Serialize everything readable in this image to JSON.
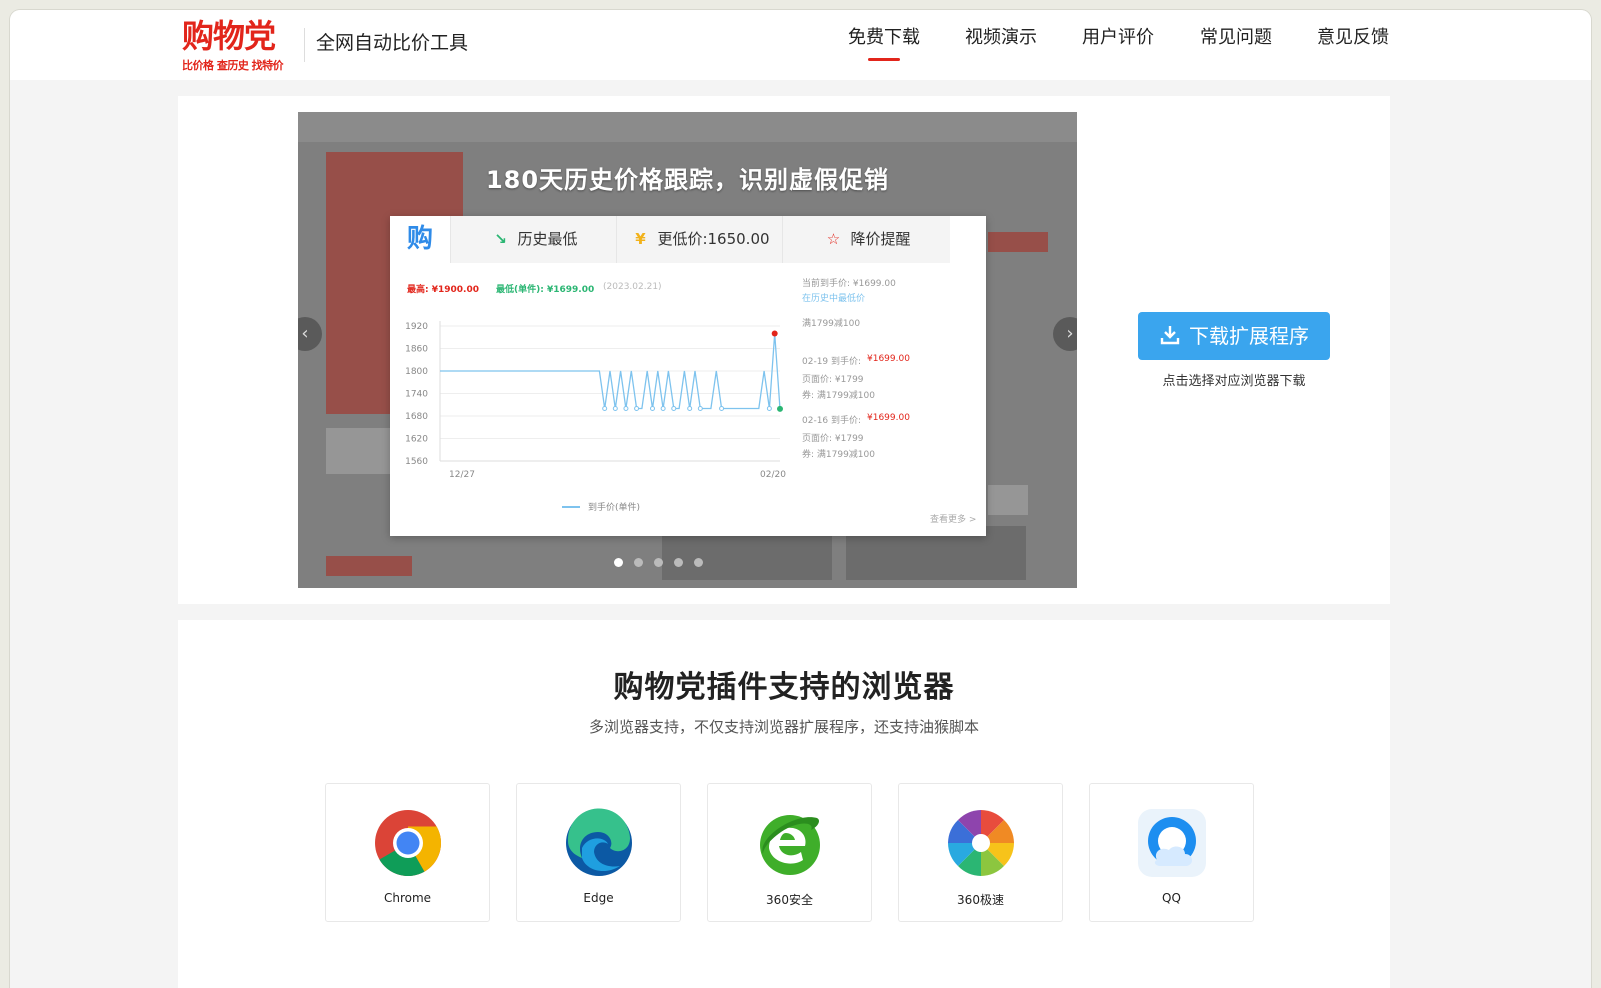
{
  "header": {
    "logo_main": "购物党",
    "logo_sub": "比价格 查历史 找特价",
    "slogan": "全网自动比价工具",
    "nav": [
      {
        "label": "免费下载",
        "active": true
      },
      {
        "label": "视频演示",
        "active": false
      },
      {
        "label": "用户评价",
        "active": false
      },
      {
        "label": "常见问题",
        "active": false
      },
      {
        "label": "意见反馈",
        "active": false
      }
    ]
  },
  "carousel": {
    "title": "180天历史价格跟踪，识别虚假促销",
    "prev_icon": "chevron-left-icon",
    "next_icon": "chevron-right-icon",
    "dots_total": 5,
    "dots_active_index": 0,
    "popup": {
      "logo": "购",
      "tabs": [
        "历史最低",
        "更低价:1650.00",
        "降价提醒"
      ],
      "max_label": "最高: ¥1900.00",
      "min_label": "最低(单件): ¥1699.00",
      "min_date": "(2023.02.21)",
      "legend": "到手价(单件)",
      "more": "查看更多 >",
      "side": {
        "current": "当前到手价: ¥1699.00",
        "history_low": "在历史中最低价",
        "coupon": "满1799减100",
        "e1_date": "02-19 到手价:",
        "e1_price": "¥1699.00",
        "e1_face": "页面价: ¥1799",
        "e1_coupon": "券: 满1799减100",
        "e2_date": "02-16 到手价:",
        "e2_price": "¥1699.00",
        "e2_face": "页面价: ¥1799",
        "e2_coupon": "券: 满1799减100"
      }
    }
  },
  "chart_data": {
    "type": "line",
    "title": "",
    "x_tick_labels": [
      "12/27",
      "02/20"
    ],
    "yticks": [
      1920,
      1860,
      1800,
      1740,
      1680,
      1620,
      1560
    ],
    "ylim": [
      1560,
      1920
    ],
    "series": [
      {
        "name": "到手价(单件)",
        "values": [
          1800,
          1800,
          1800,
          1800,
          1800,
          1800,
          1800,
          1800,
          1800,
          1800,
          1800,
          1800,
          1800,
          1800,
          1800,
          1800,
          1800,
          1800,
          1800,
          1800,
          1800,
          1800,
          1800,
          1800,
          1800,
          1800,
          1800,
          1800,
          1800,
          1800,
          1800,
          1700,
          1800,
          1700,
          1800,
          1700,
          1800,
          1700,
          1700,
          1800,
          1700,
          1800,
          1700,
          1800,
          1700,
          1700,
          1800,
          1700,
          1800,
          1700,
          1700,
          1700,
          1800,
          1700,
          1700,
          1700,
          1700,
          1700,
          1700,
          1700,
          1700,
          1800,
          1700,
          1900,
          1699
        ]
      }
    ]
  },
  "download": {
    "button_label": "下载扩展程序",
    "tip": "点击选择对应浏览器下载"
  },
  "browsers": {
    "title": "购物党插件支持的浏览器",
    "subtitle": "多浏览器支持，不仅支持浏览器扩展程序，还支持油猴脚本",
    "items": [
      {
        "name": "Chrome",
        "icon": "chrome-icon"
      },
      {
        "name": "Edge",
        "icon": "edge-icon"
      },
      {
        "name": "360安全",
        "icon": "360-safe-icon"
      },
      {
        "name": "360极速",
        "icon": "360-speed-icon"
      },
      {
        "name": "QQ",
        "icon": "qq-browser-icon"
      }
    ]
  },
  "colors": {
    "brand": "#e2251b",
    "button": "#3aa5ee",
    "chart_line": "#7ec3ee"
  }
}
